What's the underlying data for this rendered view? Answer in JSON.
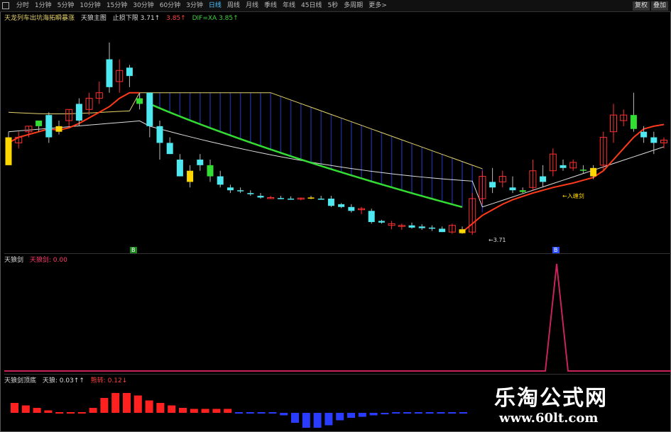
{
  "toolbar": {
    "tabs": [
      {
        "label": "分时",
        "active": false
      },
      {
        "label": "1分钟",
        "active": false
      },
      {
        "label": "5分钟",
        "active": false
      },
      {
        "label": "10分钟",
        "active": false
      },
      {
        "label": "15分钟",
        "active": false
      },
      {
        "label": "30分钟",
        "active": false
      },
      {
        "label": "60分钟",
        "active": false
      },
      {
        "label": "3分钟",
        "active": false
      },
      {
        "label": "日线",
        "active": true
      },
      {
        "label": "周线",
        "active": false
      },
      {
        "label": "月线",
        "active": false
      },
      {
        "label": "季线",
        "active": false
      },
      {
        "label": "年线",
        "active": false
      },
      {
        "label": "45日线",
        "active": false
      },
      {
        "label": "5秒",
        "active": false
      },
      {
        "label": "多周期",
        "active": false
      },
      {
        "label": "更多>",
        "active": false
      }
    ],
    "right_buttons": [
      "复权",
      "叠加"
    ]
  },
  "main_header": {
    "title": "天龙列车出坑海拓瞬暴涨",
    "indicator_name": "天狼主图",
    "line1": "止损下限 3.71↑",
    "line2": "3.85↑",
    "line3": "DIF=XA 3.85↑"
  },
  "markers": {
    "buy_label_1": "B",
    "buy_label_2": "B",
    "low_label": "←3.71",
    "annotation": "←入缠剑"
  },
  "sub1_header": {
    "name": "天狼剑",
    "value": "天狼剑: 0.00"
  },
  "sub2_header": {
    "name": "天狼剑顶底",
    "v1": "天狼: 0.03↑↑",
    "v2": "熊转: 0.12↓"
  },
  "watermark": {
    "title": "乐淘公式网",
    "url": "www.60lt.com"
  },
  "colors": {
    "up": "#ff3030",
    "down": "#4ee8f0",
    "yellow": "#ffd700",
    "green_line": "#33dd33",
    "red_line": "#ff3a1a",
    "band_fill": "#1a2a8a",
    "spike": "#c8245a",
    "hist_up": "#ff2020",
    "hist_down": "#2a3cff"
  },
  "chart_data": {
    "type": "candlestick",
    "candles": [
      {
        "o": 8,
        "h": 9,
        "l": 3,
        "c": 3,
        "col": "yellow"
      },
      {
        "o": 7,
        "h": 9,
        "l": 6,
        "c": 8,
        "col": "up"
      },
      {
        "o": 9,
        "h": 10,
        "l": 8,
        "c": 10,
        "col": "up"
      },
      {
        "o": 10,
        "h": 11,
        "l": 9,
        "c": 11,
        "col": "green"
      },
      {
        "o": 12,
        "h": 12.5,
        "l": 7,
        "c": 8,
        "col": "down"
      },
      {
        "o": 9,
        "h": 11,
        "l": 8.5,
        "c": 10,
        "col": "yellow"
      },
      {
        "o": 11,
        "h": 13,
        "l": 10,
        "c": 13,
        "col": "up"
      },
      {
        "o": 14,
        "h": 15,
        "l": 10,
        "c": 11,
        "col": "down"
      },
      {
        "o": 13,
        "h": 16,
        "l": 12,
        "c": 15,
        "col": "up"
      },
      {
        "o": 15,
        "h": 18,
        "l": 14,
        "c": 16,
        "col": "up"
      },
      {
        "o": 22,
        "h": 25,
        "l": 16,
        "c": 17,
        "col": "down"
      },
      {
        "o": 18,
        "h": 22,
        "l": 16,
        "c": 20,
        "col": "up"
      },
      {
        "o": 19,
        "h": 21,
        "l": 17,
        "c": 20.5,
        "col": "down"
      },
      {
        "o": 15,
        "h": 16,
        "l": 13,
        "c": 14,
        "col": "green"
      },
      {
        "o": 16,
        "h": 16,
        "l": 8,
        "c": 10,
        "col": "down"
      },
      {
        "o": 10,
        "h": 11,
        "l": 4,
        "c": 7,
        "col": "down"
      },
      {
        "o": 7,
        "h": 8,
        "l": 5,
        "c": 5,
        "col": "down"
      },
      {
        "o": 4,
        "h": 5,
        "l": 1,
        "c": 1,
        "col": "down"
      },
      {
        "o": 2,
        "h": 3,
        "l": -1,
        "c": 0,
        "col": "yellow"
      },
      {
        "o": 4,
        "h": 5,
        "l": 2,
        "c": 3,
        "col": "down"
      },
      {
        "o": 3,
        "h": 4,
        "l": 0,
        "c": 1,
        "col": "green"
      },
      {
        "o": 1,
        "h": 2,
        "l": -1,
        "c": -0.5,
        "col": "down"
      },
      {
        "o": -1,
        "h": -0.5,
        "l": -2,
        "c": -1.5,
        "col": "down"
      },
      {
        "o": -1.5,
        "h": -1,
        "l": -2,
        "c": -1.6,
        "col": "down"
      },
      {
        "o": -2,
        "h": -1.5,
        "l": -2.5,
        "c": -2.2,
        "col": "down"
      },
      {
        "o": -2.5,
        "h": -2,
        "l": -3,
        "c": -2.8,
        "col": "down"
      },
      {
        "o": -2.8,
        "h": -2.5,
        "l": -3,
        "c": -2.9,
        "col": "up"
      },
      {
        "o": -2.9,
        "h": -2.5,
        "l": -3.1,
        "c": -3,
        "col": "down"
      },
      {
        "o": -3,
        "h": -2.6,
        "l": -3.2,
        "c": -3.1,
        "col": "down"
      },
      {
        "o": -3.1,
        "h": -2.8,
        "l": -3.3,
        "c": -2.9,
        "col": "up"
      },
      {
        "o": -2.8,
        "h": -2.5,
        "l": -3.1,
        "c": -3.0,
        "col": "yellow"
      },
      {
        "o": -3,
        "h": -2.5,
        "l": -3.2,
        "c": -3.1,
        "col": "down"
      },
      {
        "o": -3,
        "h": -2.5,
        "l": -4.5,
        "c": -4.3,
        "col": "down"
      },
      {
        "o": -4,
        "h": -3.8,
        "l": -4.7,
        "c": -4.5,
        "col": "down"
      },
      {
        "o": -4.5,
        "h": -4,
        "l": -5.5,
        "c": -5.2,
        "col": "down"
      },
      {
        "o": -5,
        "h": -4.5,
        "l": -5.8,
        "c": -4.8,
        "col": "up"
      },
      {
        "o": -5.2,
        "h": -4.8,
        "l": -7.5,
        "c": -7.2,
        "col": "down"
      },
      {
        "o": -7,
        "h": -6.8,
        "l": -7.5,
        "c": -7.3,
        "col": "down"
      },
      {
        "o": -7.5,
        "h": -7,
        "l": -8.5,
        "c": -7.8,
        "col": "up"
      },
      {
        "o": -7.8,
        "h": -7.5,
        "l": -8.6,
        "c": -8,
        "col": "up"
      },
      {
        "o": -7.8,
        "h": -7.3,
        "l": -8.4,
        "c": -8.2,
        "col": "down"
      },
      {
        "o": -8,
        "h": -7.6,
        "l": -8.6,
        "c": -8.3,
        "col": "down"
      },
      {
        "o": -8.2,
        "h": -7.8,
        "l": -8.8,
        "c": -8.4,
        "col": "down"
      },
      {
        "o": -8.4,
        "h": -8,
        "l": -9,
        "c": -9,
        "col": "down"
      },
      {
        "o": -9,
        "h": -7.5,
        "l": -9.3,
        "c": -7.8,
        "col": "up"
      },
      {
        "o": -8.5,
        "h": -8,
        "l": -9.3,
        "c": -9.2,
        "col": "yellow"
      },
      {
        "o": -9,
        "h": -2,
        "l": -9.5,
        "c": -3,
        "col": "up"
      },
      {
        "o": -3,
        "h": 2,
        "l": -4,
        "c": 1,
        "col": "up"
      },
      {
        "o": 0,
        "h": 2.5,
        "l": -2,
        "c": -1,
        "col": "down"
      },
      {
        "o": 0,
        "h": 2,
        "l": -1,
        "c": 1,
        "col": "up"
      },
      {
        "o": -1,
        "h": 1,
        "l": -2,
        "c": -1.5,
        "col": "down"
      },
      {
        "o": -1.5,
        "h": -1,
        "l": -2,
        "c": -1.8,
        "col": "green"
      },
      {
        "o": -1,
        "h": 4,
        "l": -1.5,
        "c": 2,
        "col": "up"
      },
      {
        "o": 0,
        "h": 3,
        "l": -1,
        "c": 1,
        "col": "down"
      },
      {
        "o": 2,
        "h": 6,
        "l": 1,
        "c": 5,
        "col": "up"
      },
      {
        "o": 3,
        "h": 4,
        "l": 2,
        "c": 2.5,
        "col": "down"
      },
      {
        "o": 2.5,
        "h": 4,
        "l": 2,
        "c": 3.5,
        "col": "up"
      },
      {
        "o": 2,
        "h": 3,
        "l": 1.5,
        "c": 2.2,
        "col": "green"
      },
      {
        "o": 1,
        "h": 3,
        "l": 0.5,
        "c": 2.5,
        "col": "yellow"
      },
      {
        "o": 3,
        "h": 9,
        "l": 2,
        "c": 8,
        "col": "up"
      },
      {
        "o": 9,
        "h": 14,
        "l": 7,
        "c": 12,
        "col": "up"
      },
      {
        "o": 11,
        "h": 13,
        "l": 10,
        "c": 12,
        "col": "up"
      },
      {
        "o": 12,
        "h": 16,
        "l": 9,
        "c": 9.5,
        "col": "green"
      },
      {
        "o": 9,
        "h": 10,
        "l": 7,
        "c": 8,
        "col": "down"
      },
      {
        "o": 8,
        "h": 9,
        "l": 5,
        "c": 7,
        "col": "down"
      },
      {
        "o": 7,
        "h": 8,
        "l": 6,
        "c": 7.5,
        "col": "up"
      }
    ],
    "sub_hist": [
      2,
      1.5,
      1,
      0.5,
      0,
      0,
      0,
      1,
      3,
      4,
      4,
      3.5,
      2.5,
      2,
      1.5,
      1,
      0.8,
      0.8,
      0.8,
      0.8,
      0,
      0,
      0,
      0,
      -0.5,
      -2,
      -3,
      -3,
      -2.5,
      -1.5,
      -1,
      -0.8,
      -0.5,
      -0.3,
      0,
      0,
      0,
      0,
      0,
      0,
      0,
      0,
      0,
      0,
      0,
      0,
      0,
      0,
      0,
      0,
      0,
      0,
      0,
      0,
      0,
      0,
      0,
      0,
      0,
      0,
      0,
      0,
      0,
      0,
      0,
      0
    ],
    "spike_index": 49
  }
}
